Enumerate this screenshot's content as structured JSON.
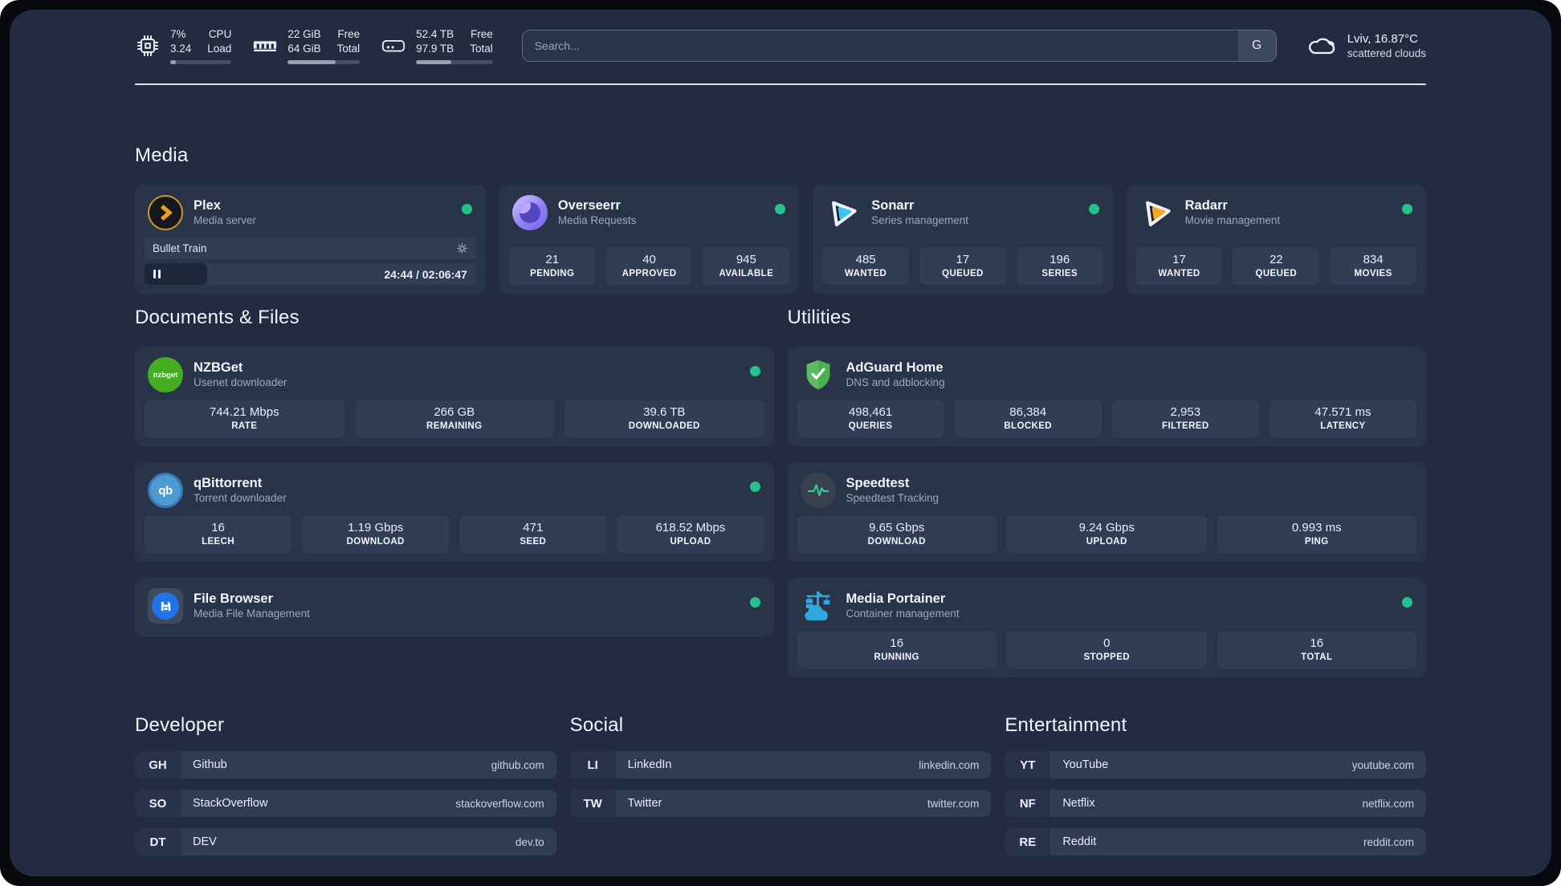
{
  "topbar": {
    "cpu": {
      "line1": "7%",
      "line2": "3.24",
      "label1": "CPU",
      "label2": "Load",
      "progress": 9
    },
    "memory": {
      "line1": "22 GiB",
      "line2": "64 GiB",
      "label1": "Free",
      "label2": "Total",
      "progress": 66
    },
    "disk": {
      "line1": "52.4 TB",
      "line2": "97.9 TB",
      "label1": "Free",
      "label2": "Total",
      "progress": 46
    },
    "search": {
      "placeholder": "Search...",
      "provider_button": "G"
    },
    "weather": {
      "location": "Lviv, 16.87°C",
      "condition": "scattered clouds"
    }
  },
  "sections": {
    "media": "Media",
    "documents": "Documents & Files",
    "utilities": "Utilities",
    "developer": "Developer",
    "social": "Social",
    "entertainment": "Entertainment"
  },
  "services": {
    "plex": {
      "name": "Plex",
      "desc": "Media server",
      "now_playing": "Bullet Train",
      "time": "24:44 / 02:06:47",
      "progress": 19
    },
    "overseerr": {
      "name": "Overseerr",
      "desc": "Media Requests",
      "stats": [
        {
          "value": "21",
          "label": "PENDING"
        },
        {
          "value": "40",
          "label": "APPROVED"
        },
        {
          "value": "945",
          "label": "AVAILABLE"
        }
      ]
    },
    "sonarr": {
      "name": "Sonarr",
      "desc": "Series management",
      "stats": [
        {
          "value": "485",
          "label": "WANTED"
        },
        {
          "value": "17",
          "label": "QUEUED"
        },
        {
          "value": "196",
          "label": "SERIES"
        }
      ]
    },
    "radarr": {
      "name": "Radarr",
      "desc": "Movie management",
      "stats": [
        {
          "value": "17",
          "label": "WANTED"
        },
        {
          "value": "22",
          "label": "QUEUED"
        },
        {
          "value": "834",
          "label": "MOVIES"
        }
      ]
    },
    "nzbget": {
      "name": "NZBGet",
      "desc": "Usenet downloader",
      "icon_text": "nzbget",
      "stats": [
        {
          "value": "744.21 Mbps",
          "label": "RATE"
        },
        {
          "value": "266 GB",
          "label": "REMAINING"
        },
        {
          "value": "39.6 TB",
          "label": "DOWNLOADED"
        }
      ]
    },
    "qbittorrent": {
      "name": "qBittorrent",
      "desc": "Torrent downloader",
      "icon_text": "qb",
      "stats": [
        {
          "value": "16",
          "label": "LEECH"
        },
        {
          "value": "1.19 Gbps",
          "label": "DOWNLOAD"
        },
        {
          "value": "471",
          "label": "SEED"
        },
        {
          "value": "618.52 Mbps",
          "label": "UPLOAD"
        }
      ]
    },
    "filebrowser": {
      "name": "File Browser",
      "desc": "Media File Management"
    },
    "adguard": {
      "name": "AdGuard Home",
      "desc": "DNS and adblocking",
      "stats": [
        {
          "value": "498,461",
          "label": "QUERIES"
        },
        {
          "value": "86,384",
          "label": "BLOCKED"
        },
        {
          "value": "2,953",
          "label": "FILTERED"
        },
        {
          "value": "47.571 ms",
          "label": "LATENCY"
        }
      ]
    },
    "speedtest": {
      "name": "Speedtest",
      "desc": "Speedtest Tracking",
      "stats": [
        {
          "value": "9.65 Gbps",
          "label": "DOWNLOAD"
        },
        {
          "value": "9.24 Gbps",
          "label": "UPLOAD"
        },
        {
          "value": "0.993 ms",
          "label": "PING"
        }
      ]
    },
    "portainer": {
      "name": "Media Portainer",
      "desc": "Container management",
      "stats": [
        {
          "value": "16",
          "label": "RUNNING"
        },
        {
          "value": "0",
          "label": "STOPPED"
        },
        {
          "value": "16",
          "label": "TOTAL"
        }
      ]
    }
  },
  "bookmarks": {
    "developer": [
      {
        "abbr": "GH",
        "name": "Github",
        "domain": "github.com"
      },
      {
        "abbr": "SO",
        "name": "StackOverflow",
        "domain": "stackoverflow.com"
      },
      {
        "abbr": "DT",
        "name": "DEV",
        "domain": "dev.to"
      }
    ],
    "social": [
      {
        "abbr": "LI",
        "name": "LinkedIn",
        "domain": "linkedin.com"
      },
      {
        "abbr": "TW",
        "name": "Twitter",
        "domain": "twitter.com"
      }
    ],
    "entertainment": [
      {
        "abbr": "YT",
        "name": "YouTube",
        "domain": "youtube.com"
      },
      {
        "abbr": "NF",
        "name": "Netflix",
        "domain": "netflix.com"
      },
      {
        "abbr": "RE",
        "name": "Reddit",
        "domain": "reddit.com"
      }
    ]
  },
  "colors": {
    "status_online": "#27c28b",
    "accent_portainer": "#2fa8e0",
    "accent_sonarr": "#3cc3f2",
    "accent_radarr": "#f2a71c",
    "accent_plex": "#e8a11b",
    "accent_adguard": "#5dbb63",
    "accent_speedtest": "#2fd49a"
  }
}
